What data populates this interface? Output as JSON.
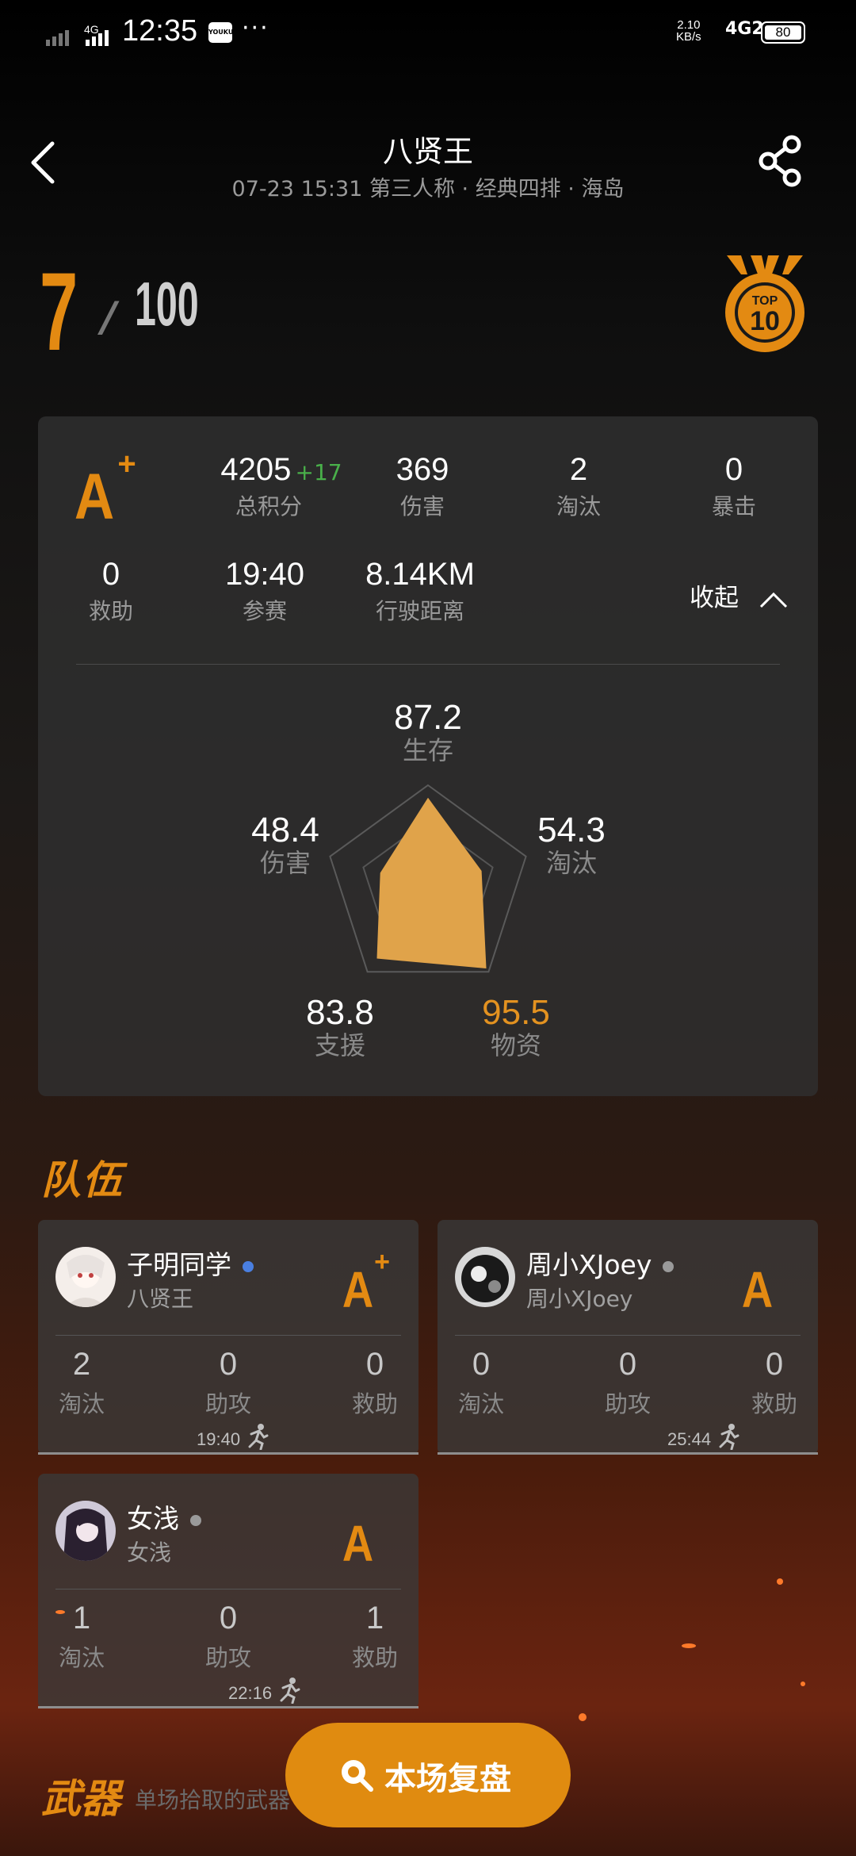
{
  "status_bar": {
    "signal": "4G",
    "time": "12:35",
    "app_badge": "YOUKU",
    "dots": "···",
    "net_speed_value": "2.10",
    "net_speed_unit": "KB/s",
    "network": "4G2",
    "battery": "80"
  },
  "header": {
    "title": "八贤王",
    "subtitle": "07-23 15:31 第三人称 · 经典四排 · 海岛"
  },
  "rank": {
    "position": "7",
    "separator": "/",
    "total": "100",
    "badge_line1": "TOP",
    "badge_line2": "10"
  },
  "stats": {
    "grade": "A",
    "grade_plus": "+",
    "total_score": "4205",
    "score_delta": "+17",
    "score_label": "总积分",
    "damage": "369",
    "damage_label": "伤害",
    "kills": "2",
    "kills_label": "淘汰",
    "crits": "0",
    "crits_label": "暴击",
    "assists": "0",
    "assists_label": "救助",
    "time_played": "19:40",
    "time_label": "参赛",
    "distance": "8.14KM",
    "distance_label": "行驶距离",
    "collapse_label": "收起"
  },
  "radar": {
    "survival": "87.2",
    "survival_label": "生存",
    "damage": "48.4",
    "damage_label": "伤害",
    "kills": "54.3",
    "kills_label": "淘汰",
    "support": "83.8",
    "support_label": "支援",
    "supplies": "95.5",
    "supplies_label": "物资",
    "scale_max": 100,
    "fill_color": "#e0a34a",
    "highlight_color": "#e39220"
  },
  "team": {
    "title": "队伍",
    "members": [
      {
        "name": "子明同学",
        "sub": "八贤王",
        "status_color": "#4a7fe0",
        "grade": "A",
        "grade_plus": "+",
        "kills": "2",
        "assists": "0",
        "revives": "0",
        "time": "19:40"
      },
      {
        "name": "周小XJoey",
        "sub": "周小XJoey",
        "status_color": "#9a9a9a",
        "grade": "A",
        "grade_plus": "",
        "kills": "0",
        "assists": "0",
        "revives": "0",
        "time": "25:44"
      },
      {
        "name": "女浅",
        "sub": "女浅",
        "status_color": "#9a9a9a",
        "grade": "A",
        "grade_plus": "",
        "kills": "1",
        "assists": "0",
        "revives": "1",
        "time": "22:16"
      }
    ],
    "kills_label": "淘汰",
    "assists_label": "助攻",
    "revives_label": "救助"
  },
  "weapons": {
    "title": "武器",
    "subtitle": "单场拾取的武器"
  },
  "replay_button": {
    "label": "本场复盘"
  }
}
